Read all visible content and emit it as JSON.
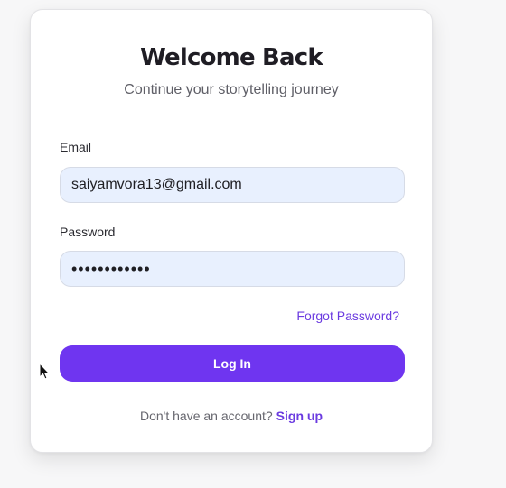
{
  "login_card": {
    "title": "Welcome Back",
    "subtitle": "Continue your storytelling journey",
    "email": {
      "label": "Email",
      "value": "saiyamvora13@gmail.com"
    },
    "password": {
      "label": "Password",
      "masked_value": "••••••••••••"
    },
    "forgot_password_label": "Forgot Password?",
    "login_button_label": "Log In",
    "signup_prompt": "Don't have an account?",
    "signup_link_label": "Sign up"
  },
  "colors": {
    "accent": "#6f35f0",
    "input_background": "#e8f0fe",
    "card_background": "#ffffff",
    "page_background": "#f7f7f8"
  },
  "icons": {
    "pointer": "mouse-pointer-icon"
  }
}
